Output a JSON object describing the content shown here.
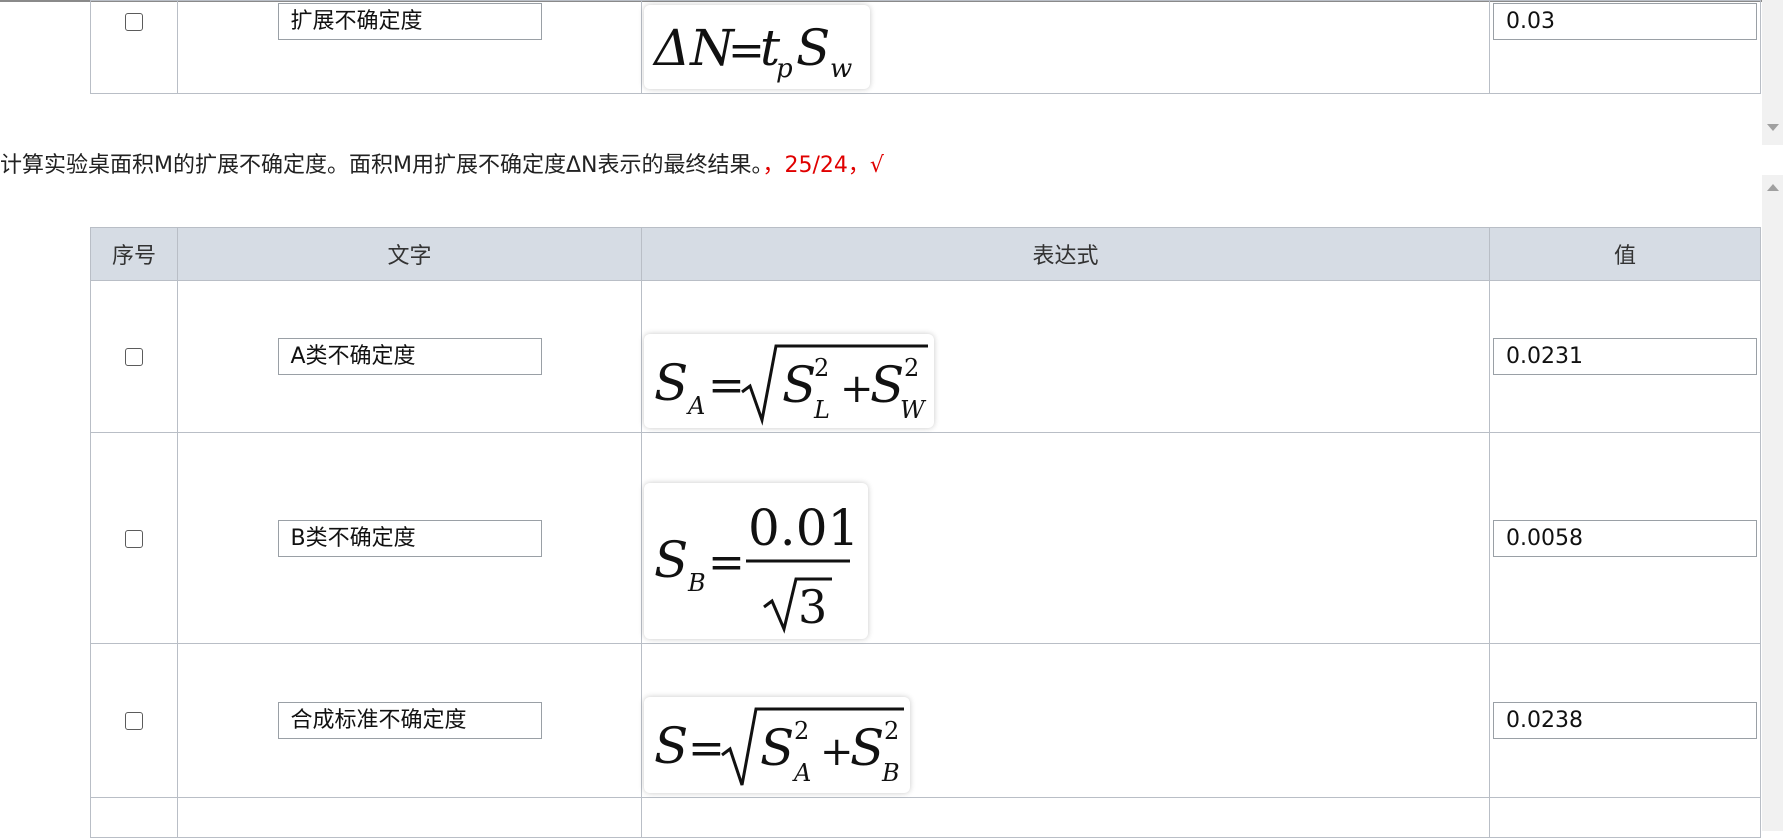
{
  "top_table": {
    "row": {
      "text": "扩展不确定度",
      "value": "0.03"
    }
  },
  "instruction": {
    "text": "计算实验桌面积M的扩展不确定度。面积M用扩展不确定度ΔN表示的最终结果。",
    "status": "，25/24，√"
  },
  "table": {
    "headers": {
      "index": "序号",
      "text": "文字",
      "expression": "表达式",
      "value": "值"
    },
    "rows": [
      {
        "text": "A类不确定度",
        "value": "0.0231"
      },
      {
        "text": "B类不确定度",
        "value": "0.0058"
      },
      {
        "text": "合成标准不确定度",
        "value": "0.0238"
      }
    ]
  },
  "colors": {
    "header_bg": "#d6dce4",
    "border": "#b9bec6",
    "status_red": "#e00000"
  }
}
